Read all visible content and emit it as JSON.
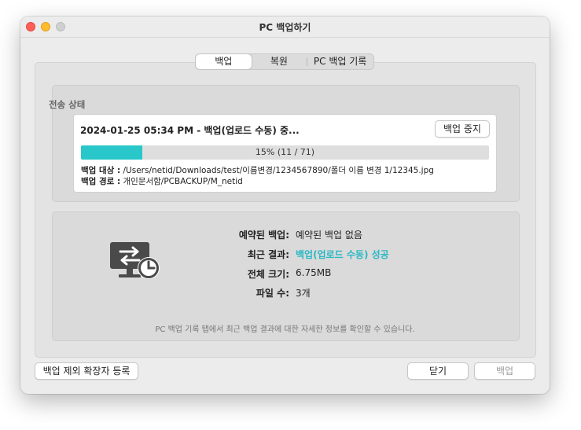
{
  "window": {
    "title": "PC 백업하기"
  },
  "tabs": [
    {
      "label": "백업",
      "active": true
    },
    {
      "label": "복원",
      "active": false
    },
    {
      "label": "PC 백업 기록",
      "active": false
    }
  ],
  "status": {
    "heading": "전송 상태",
    "line": "2024-01-25 05:34 PM - 백업(업로드 수동) 중...",
    "stop_button": "백업 중지",
    "progress_fraction": 0.15,
    "progress_text": "15% (11 / 71)",
    "target_label": "백업 대상 :",
    "target_value": "/Users/netid/Downloads/test/이름변경/1234567890/폴더 이름 변경 1/12345.jpg",
    "path_label": "백업 경로 :",
    "path_value": "개인문서함/PCBACKUP/M_netid"
  },
  "summary": {
    "icon": "monitor-sync-clock-icon",
    "scheduled_label": "예약된 백업:",
    "scheduled_value": "예약된 백업 없음",
    "recent_label": "최근 결과:",
    "recent_value": "백업(업로드 수동) 성공",
    "size_label": "전체 크기:",
    "size_value": "6.75MB",
    "files_label": "파일 수:",
    "files_value": "3개",
    "footnote": "PC 백업 기록 탭에서 최근 백업 결과에 대한 자세한 정보를 확인할 수 있습니다."
  },
  "footer": {
    "exclude_button": "백업 제외 확장자 등록",
    "close_button": "닫기",
    "backup_button": "백업"
  },
  "colors": {
    "accent": "#29c7c9",
    "close": "#fe5f57",
    "minimize": "#febc2e"
  }
}
